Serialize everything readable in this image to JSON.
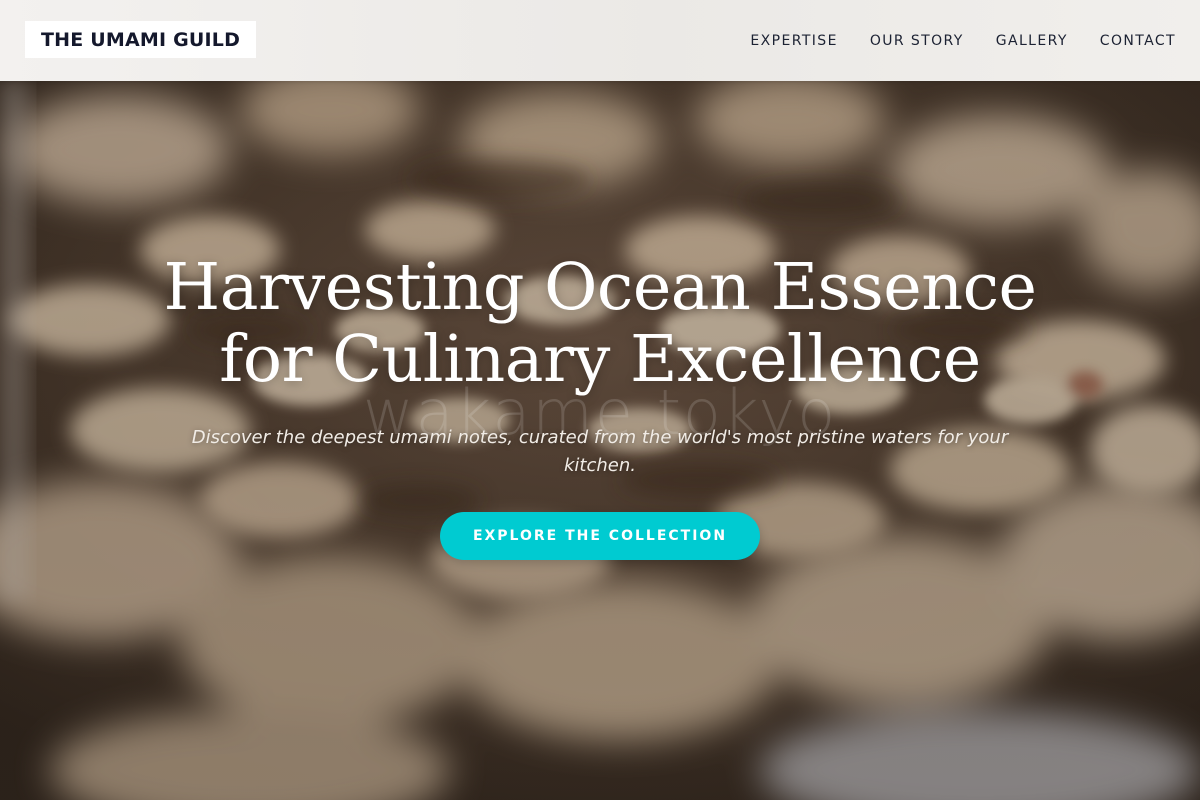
{
  "header": {
    "logo": "THE UMAMI GUILD",
    "nav": [
      "EXPERTISE",
      "OUR STORY",
      "GALLERY",
      "CONTACT"
    ]
  },
  "hero": {
    "title_line1": "Harvesting Ocean Essence",
    "title_line2": "for Culinary Excellence",
    "watermark": "wakame tokyo",
    "subtitle": "Discover the deepest umami notes, curated from the world's most pristine waters for your kitchen.",
    "cta_label": "EXPLORE THE COLLECTION",
    "background_image": "blurred-nuts-photo"
  },
  "colors": {
    "accent": "#00cbd1",
    "logo_text": "#14182c",
    "header_bg": "#eeece9",
    "nav_text": "#1c2233"
  }
}
